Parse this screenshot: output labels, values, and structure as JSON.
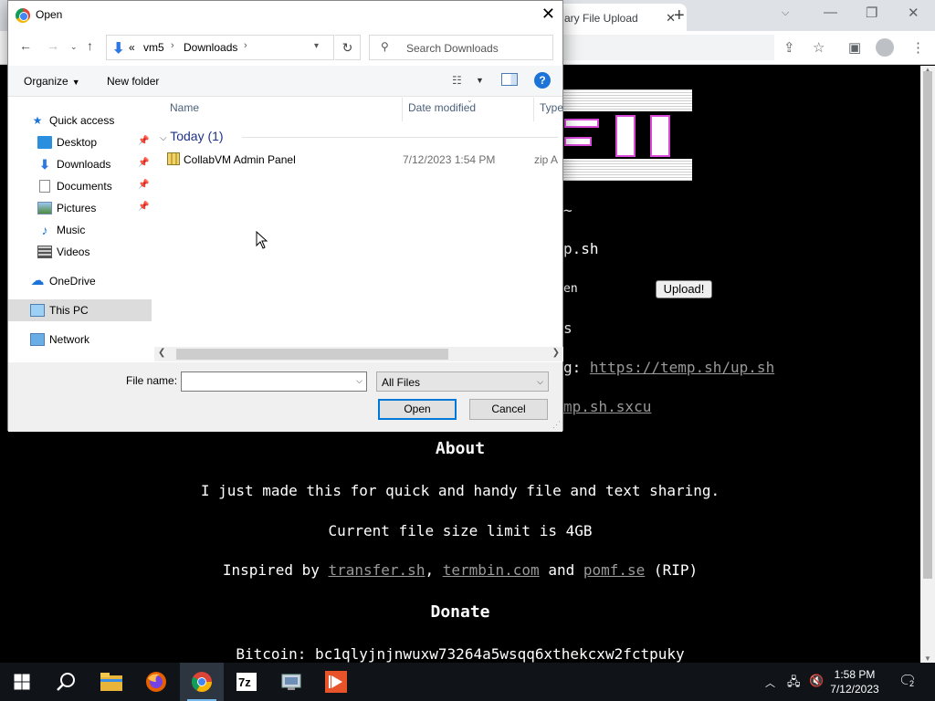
{
  "browser": {
    "tab_title": "ary File Upload",
    "tab_close": "✕",
    "new_tab": "+",
    "tabs_dropdown": "⌵",
    "minimize": "—",
    "restore": "❐",
    "close": "✕"
  },
  "page": {
    "lines": [
      {
        "text": "~"
      },
      {
        "text": "p.sh"
      },
      {
        "text": "en"
      },
      {
        "text": "s"
      }
    ],
    "upload_button": "Upload!",
    "line_g_prefix": "g: ",
    "line_g_link": "https://temp.sh/up.sh",
    "line_mp_link": "mp.sh.sxcu",
    "about_heading": "About",
    "about_line1": "I just made this for quick and handy file and text sharing.",
    "about_line2": "Current file size limit is 4GB",
    "inspired_prefix": "Inspired by ",
    "inspired_link1": "transfer.sh",
    "inspired_sep": ", ",
    "inspired_link2": "termbin.com",
    "inspired_and": " and ",
    "inspired_link3": "pomf.se",
    "inspired_suffix": " (RIP)",
    "donate_heading": "Donate",
    "bitcoin": "Bitcoin: bc1qlyjnjnwuxw73264a5wsqq6xthekcxw2fctpuky"
  },
  "dialog": {
    "title": "Open",
    "close": "✕",
    "address": {
      "overflow": "«",
      "crumbs": [
        "vm5",
        "Downloads"
      ],
      "sep": "›"
    },
    "search_placeholder": "Search Downloads",
    "organize": "Organize",
    "new_folder": "New folder",
    "help": "?",
    "nav_items": [
      {
        "label": "Quick access"
      },
      {
        "label": "Desktop"
      },
      {
        "label": "Downloads"
      },
      {
        "label": "Documents"
      },
      {
        "label": "Pictures"
      },
      {
        "label": "Music"
      },
      {
        "label": "Videos"
      },
      {
        "label": "OneDrive"
      },
      {
        "label": "This PC"
      },
      {
        "label": "Network"
      }
    ],
    "columns": {
      "name": "Name",
      "date": "Date modified",
      "type": "Type"
    },
    "group": "Today (1)",
    "files": [
      {
        "name": "CollabVM Admin Panel",
        "date": "7/12/2023 1:54 PM",
        "type": "zip A"
      }
    ],
    "file_name_label": "File name:",
    "file_name_value": "",
    "filter": "All Files",
    "open_button": "Open",
    "cancel_button": "Cancel"
  },
  "taskbar": {
    "time": "1:58 PM",
    "date": "7/12/2023",
    "notifications_count": "2",
    "icons": [
      "windows-start-icon",
      "search-icon",
      "file-explorer-icon",
      "firefox-icon",
      "chrome-icon",
      "7zip-icon",
      "network-tool-icon",
      "media-app-icon"
    ]
  },
  "colors": {
    "accent": "#0078d7",
    "page_bg": "#000000",
    "link": "#999999",
    "taskbar": "#101418"
  }
}
